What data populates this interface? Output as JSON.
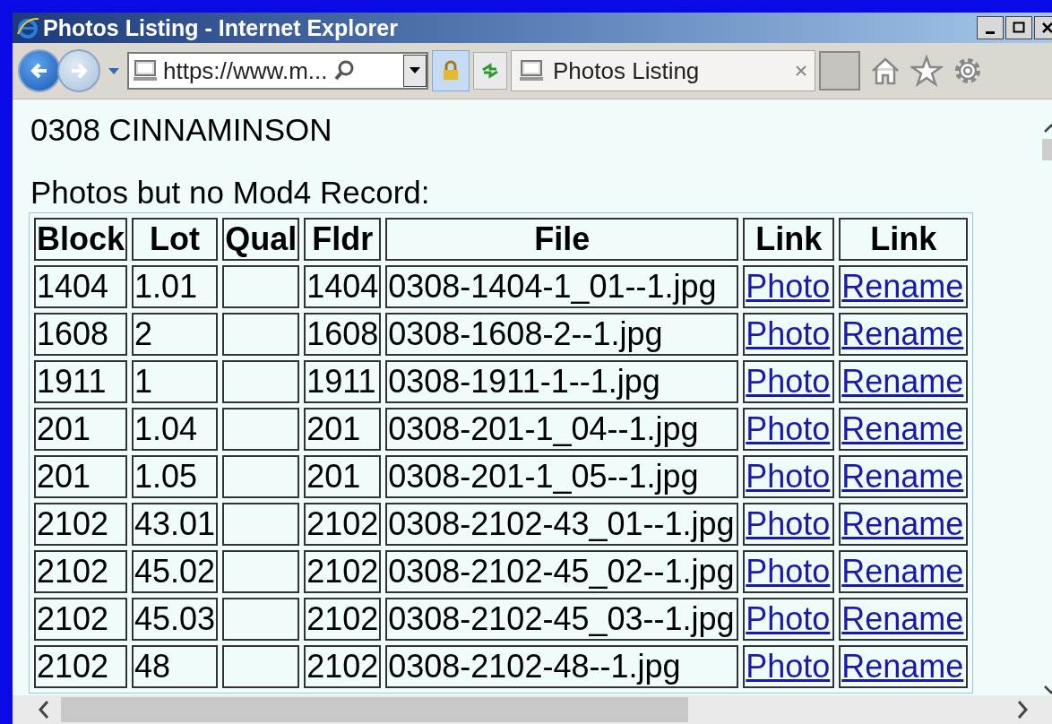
{
  "window": {
    "title": "Photos Listing - Internet Explorer"
  },
  "toolbar": {
    "address": "https://www.m...",
    "tab": {
      "label": "Photos Listing",
      "selected": true
    }
  },
  "page": {
    "heading": "0308 CINNAMINSON",
    "subheading": "Photos but no Mod4 Record:",
    "table": {
      "columns": [
        "Block",
        "Lot",
        "Qual",
        "Fldr",
        "File",
        "Link",
        "Link"
      ],
      "rows": [
        {
          "block": "1404",
          "lot": "1.01",
          "fldr": "1404",
          "file": "0308-1404-1_01--1.jpg",
          "photo": "Photo",
          "rename": "Rename"
        },
        {
          "block": "1608",
          "lot": "2",
          "fldr": "1608",
          "file": "0308-1608-2--1.jpg",
          "photo": "Photo",
          "rename": "Rename"
        },
        {
          "block": "1911",
          "lot": "1",
          "fldr": "1911",
          "file": "0308-1911-1--1.jpg",
          "photo": "Photo",
          "rename": "Rename"
        },
        {
          "block": "201",
          "lot": "1.04",
          "fldr": "201",
          "file": "0308-201-1_04--1.jpg",
          "photo": "Photo",
          "rename": "Rename"
        },
        {
          "block": "201",
          "lot": "1.05",
          "fldr": "201",
          "file": "0308-201-1_05--1.jpg",
          "photo": "Photo",
          "rename": "Rename"
        },
        {
          "block": "2102",
          "lot": "43.01",
          "fldr": "2102",
          "file": "0308-2102-43_01--1.jpg",
          "photo": "Photo",
          "rename": "Rename"
        },
        {
          "block": "2102",
          "lot": "45.02",
          "fldr": "2102",
          "file": "0308-2102-45_02--1.jpg",
          "photo": "Photo",
          "rename": "Rename"
        },
        {
          "block": "2102",
          "lot": "45.03",
          "fldr": "2102",
          "file": "0308-2102-45_03--1.jpg",
          "photo": "Photo",
          "rename": "Rename"
        },
        {
          "block": "2102",
          "lot": "48",
          "fldr": "2102",
          "file": "0308-2102-48--1.jpg",
          "photo": "Photo",
          "rename": "Rename"
        }
      ]
    }
  }
}
